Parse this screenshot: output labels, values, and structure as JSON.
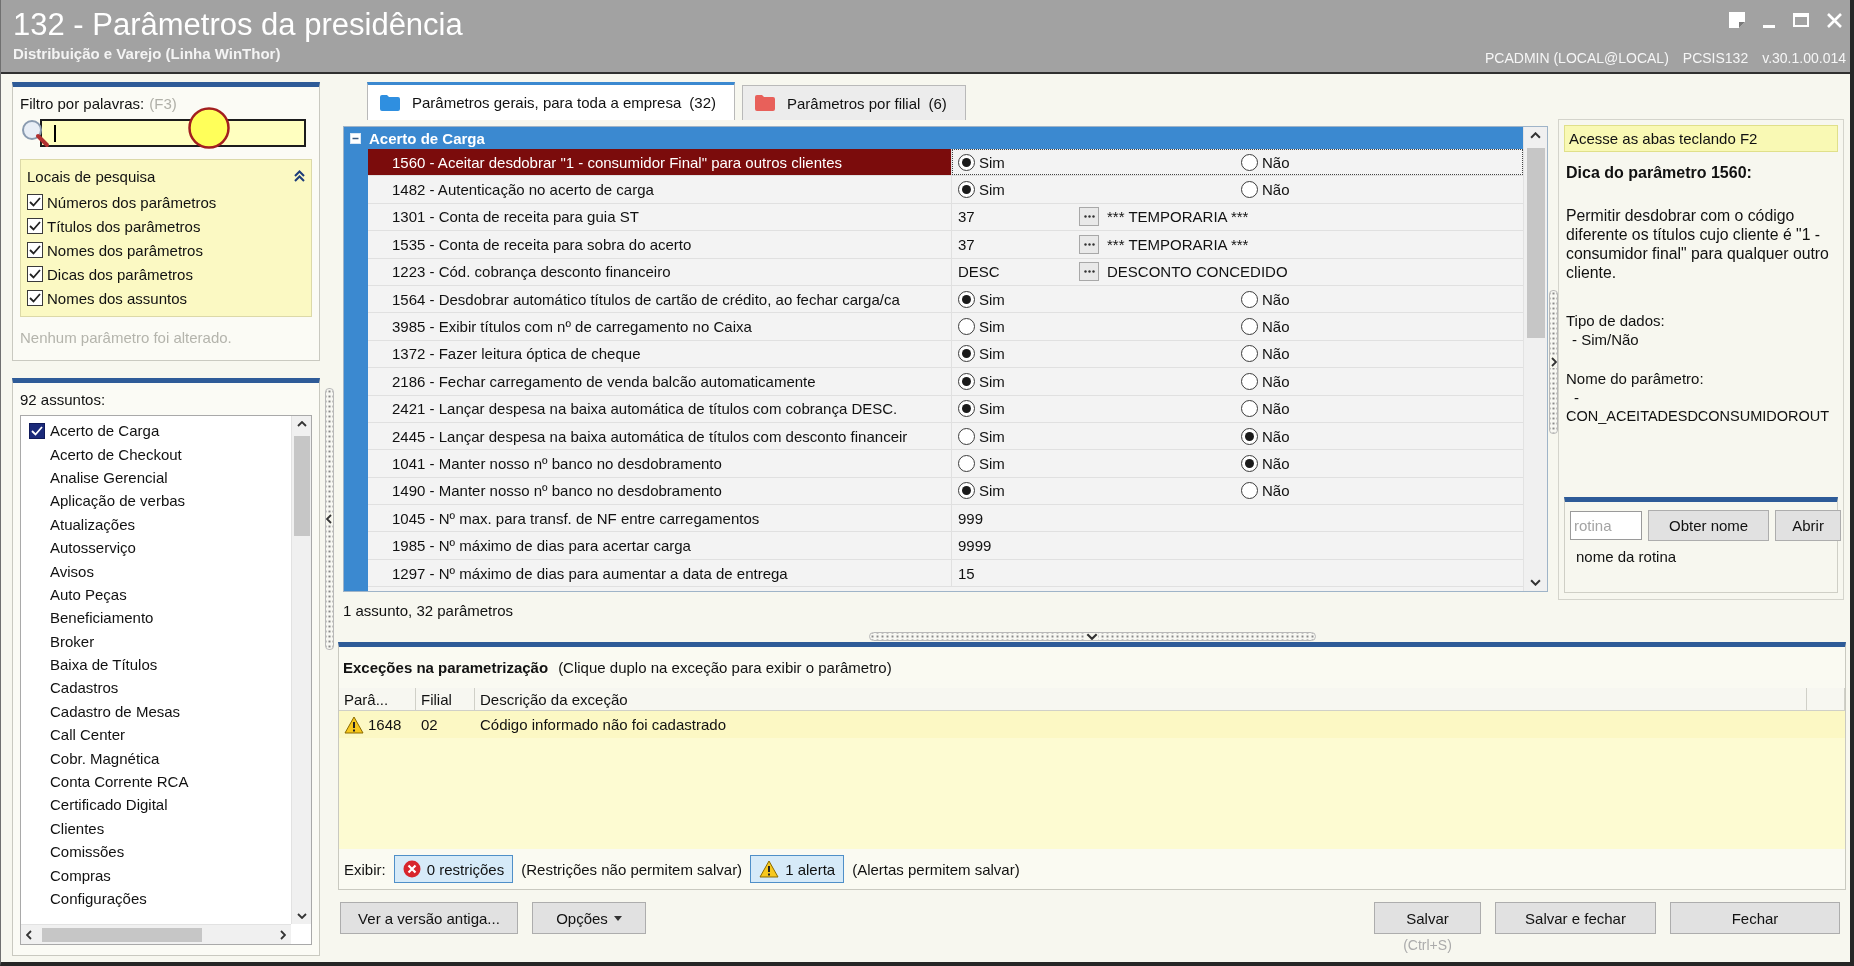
{
  "window": {
    "title": "132 - Parâmetros da presidência",
    "subtitle": "Distribuição e Varejo (Linha WinThor)",
    "user": "PCADMIN (LOCAL@LOCAL)",
    "routine": "PCSIS132",
    "version": "v.30.1.00.014"
  },
  "filter": {
    "label": "Filtro por palavras:",
    "shortcut": "(F3)"
  },
  "search_locations": {
    "title": "Locais de pesquisa",
    "expanded": true,
    "options": [
      {
        "label": "Números dos parâmetros",
        "checked": true
      },
      {
        "label": "Títulos dos parâmetros",
        "checked": true
      },
      {
        "label": "Nomes dos parâmetros",
        "checked": true
      },
      {
        "label": "Dicas dos parâmetros",
        "checked": true
      },
      {
        "label": "Nomes dos assuntos",
        "checked": true
      }
    ]
  },
  "change_status": "Nenhum parâmetro foi alterado.",
  "subjects": {
    "count_label": "92 assuntos:",
    "items": [
      {
        "label": "Acerto de Carga",
        "checked": true
      },
      {
        "label": "Acerto de Checkout",
        "checked": false
      },
      {
        "label": "Analise Gerencial",
        "checked": false
      },
      {
        "label": "Aplicação de verbas",
        "checked": false
      },
      {
        "label": "Atualizações",
        "checked": false
      },
      {
        "label": "Autosserviço",
        "checked": false
      },
      {
        "label": "Avisos",
        "checked": false
      },
      {
        "label": "Auto Peças",
        "checked": false
      },
      {
        "label": "Beneficiamento",
        "checked": false
      },
      {
        "label": "Broker",
        "checked": false
      },
      {
        "label": "Baixa de Títulos",
        "checked": false
      },
      {
        "label": "Cadastros",
        "checked": false
      },
      {
        "label": "Cadastro de Mesas",
        "checked": false
      },
      {
        "label": "Call Center",
        "checked": false
      },
      {
        "label": "Cobr. Magnética",
        "checked": false
      },
      {
        "label": "Conta Corrente RCA",
        "checked": false
      },
      {
        "label": "Certificado Digital",
        "checked": false
      },
      {
        "label": "Clientes",
        "checked": false
      },
      {
        "label": "Comissões",
        "checked": false
      },
      {
        "label": "Compras",
        "checked": false
      },
      {
        "label": "Configurações",
        "checked": false
      }
    ]
  },
  "tabs": [
    {
      "label": "Parâmetros gerais, para toda a empresa",
      "count": "(32)",
      "selected": true,
      "color": "#2f8fe0"
    },
    {
      "label": "Parâmetros por filial",
      "count": "(6)",
      "selected": false,
      "color": "#e8605a"
    }
  ],
  "grid": {
    "group": {
      "title": "Acerto de Carga",
      "expanded": true
    },
    "rows": [
      {
        "name": "1560 - Aceitar desdobrar \"1 - consumidor Final\" para outros clientes",
        "kind": "radio",
        "selected": true,
        "options": [
          {
            "label": "Sim",
            "selected": true
          },
          {
            "label": "Não",
            "selected": false
          }
        ]
      },
      {
        "name": "1482 - Autenticação no acerto de carga",
        "kind": "radio",
        "selected": false,
        "options": [
          {
            "label": "Sim",
            "selected": true
          },
          {
            "label": "Não",
            "selected": false
          }
        ]
      },
      {
        "name": "1301 - Conta de receita para guia ST",
        "kind": "lookup",
        "selected": false,
        "value": "37",
        "description": "*** TEMPORARIA ***"
      },
      {
        "name": "1535 - Conta de receita para sobra do acerto",
        "kind": "lookup",
        "selected": false,
        "value": "37",
        "description": "*** TEMPORARIA ***"
      },
      {
        "name": "1223 - Cód. cobrança desconto financeiro",
        "kind": "lookup",
        "selected": false,
        "value": "DESC",
        "description": "DESCONTO CONCEDIDO"
      },
      {
        "name": "1564 - Desdobrar automático títulos de cartão de crédito, ao fechar carga/ca",
        "kind": "radio",
        "selected": false,
        "options": [
          {
            "label": "Sim",
            "selected": true
          },
          {
            "label": "Não",
            "selected": false
          }
        ]
      },
      {
        "name": "3985 - Exibir títulos com nº de carregamento no Caixa",
        "kind": "radio",
        "selected": false,
        "options": [
          {
            "label": "Sim",
            "selected": false
          },
          {
            "label": "Não",
            "selected": false
          }
        ]
      },
      {
        "name": "1372 - Fazer leitura óptica de cheque",
        "kind": "radio",
        "selected": false,
        "options": [
          {
            "label": "Sim",
            "selected": true
          },
          {
            "label": "Não",
            "selected": false
          }
        ]
      },
      {
        "name": "2186 - Fechar carregamento de venda balcão automaticamente",
        "kind": "radio",
        "selected": false,
        "options": [
          {
            "label": "Sim",
            "selected": true
          },
          {
            "label": "Não",
            "selected": false
          }
        ]
      },
      {
        "name": "2421 - Lançar despesa na baixa automática de títulos com cobrança DESC.",
        "kind": "radio",
        "selected": false,
        "options": [
          {
            "label": "Sim",
            "selected": true
          },
          {
            "label": "Não",
            "selected": false
          }
        ]
      },
      {
        "name": "2445 - Lançar despesa na baixa automática de títulos com desconto financeir",
        "kind": "radio",
        "selected": false,
        "options": [
          {
            "label": "Sim",
            "selected": false
          },
          {
            "label": "Não",
            "selected": true
          }
        ]
      },
      {
        "name": "1041 - Manter nosso nº banco no desdobramento",
        "kind": "radio",
        "selected": false,
        "options": [
          {
            "label": "Sim",
            "selected": false
          },
          {
            "label": "Não",
            "selected": true
          }
        ]
      },
      {
        "name": "1490 - Manter nosso nº banco no desdobramento",
        "kind": "radio",
        "selected": false,
        "options": [
          {
            "label": "Sim",
            "selected": true
          },
          {
            "label": "Não",
            "selected": false
          }
        ]
      },
      {
        "name": "1045 - Nº max. para transf. de NF entre carregamentos",
        "kind": "text",
        "selected": false,
        "value": "999"
      },
      {
        "name": "1985 - Nº máximo de dias para acertar carga",
        "kind": "text",
        "selected": false,
        "value": "9999"
      },
      {
        "name": "1297 - Nº máximo de dias para aumentar a data de entrega",
        "kind": "text",
        "selected": false,
        "value": "15"
      }
    ]
  },
  "grid_summary": "1 assunto, 32 parâmetros",
  "hint_panel": {
    "shortcut_hint": "Acesse as abas teclando F2",
    "title": "Dica do parâmetro 1560:",
    "description": "Permitir desdobrar com o código diferente os títulos cujo cliente é \"1 - consumidor final\" para qualquer outro cliente.",
    "data_type_label": "Tipo de dados:",
    "data_type": "- Sim/Não",
    "name_label": "Nome do parâmetro:",
    "name_dash": "-",
    "name": "CON_ACEITADESDCONSUMIDOROUT"
  },
  "routine_lookup": {
    "placeholder": "rotina",
    "buttons": [
      {
        "label": "Obter nome"
      },
      {
        "label": "Abrir"
      }
    ],
    "result": "nome da rotina"
  },
  "exceptions": {
    "title": "Exceções na parametrização",
    "hint": "(Clique duplo na exceção para exibir o parâmetro)",
    "columns": [
      "Parâ...",
      "Filial",
      "Descrição da exceção"
    ],
    "rows": [
      {
        "kind": "alert",
        "parameter": "1648",
        "branch": "02",
        "description": "Código informado não foi cadastrado"
      }
    ],
    "filter_label": "Exibir:",
    "filters": [
      {
        "kind": "restriction",
        "label": "0 restrições",
        "note": "(Restrições não permitem salvar)"
      },
      {
        "kind": "alert",
        "label": "1 alerta",
        "note": "(Alertas permitem salvar)"
      }
    ]
  },
  "left_buttons": [
    {
      "label": "Ver a versão antiga...",
      "kind": "plain"
    },
    {
      "label": "Opções",
      "kind": "menu"
    }
  ],
  "right_buttons": [
    {
      "label": "Salvar",
      "kind": "plain",
      "shortcut": "(Ctrl+S)"
    },
    {
      "label": "Salvar e fechar",
      "kind": "plain"
    },
    {
      "label": "Fechar",
      "kind": "plain"
    }
  ]
}
